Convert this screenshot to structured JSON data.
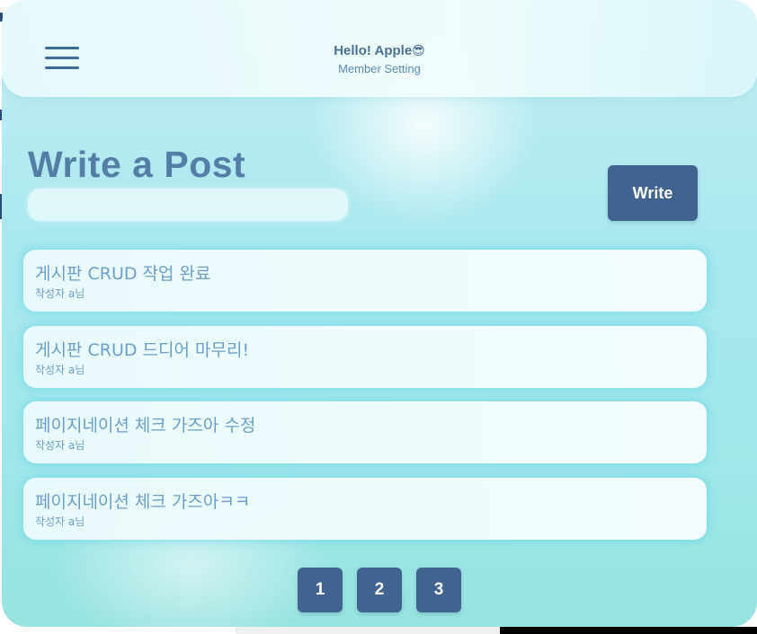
{
  "header": {
    "greeting": "Hello! Apple",
    "greeting_emoji": "😎",
    "member_setting": "Member Setting"
  },
  "main": {
    "title": "Write a Post",
    "title_input_value": "",
    "write_label": "Write"
  },
  "posts": [
    {
      "title": "게시판 CRUD 작업 완료",
      "author": "작성자 a님"
    },
    {
      "title": "게시판 CRUD 드디어 마무리!",
      "author": "작성자 a님"
    },
    {
      "title": "페이지네이션 체크 가즈아 수정",
      "author": "작성자 a님"
    },
    {
      "title": "페이지네이션 체크 가즈아ㅋㅋ",
      "author": "작성자 a님"
    }
  ],
  "pagination": [
    "1",
    "2",
    "3"
  ],
  "colors": {
    "accent": "#41638f",
    "title_text": "#547ea6",
    "post_text": "#6b9fc7",
    "background": "#a8e8ef"
  },
  "icons": {
    "menu": "hamburger-menu-icon"
  }
}
